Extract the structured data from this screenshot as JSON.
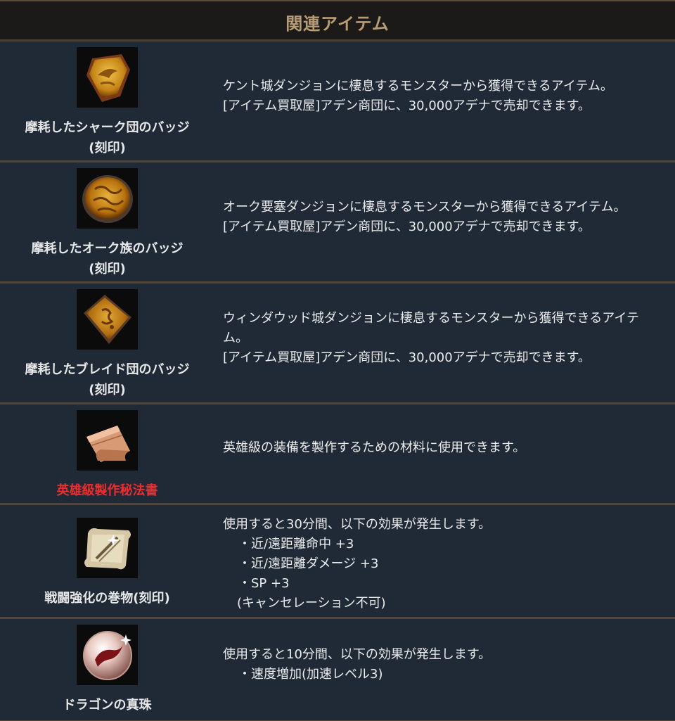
{
  "header": {
    "title": "関連アイテム"
  },
  "items": [
    {
      "icon": "shark-badge-icon",
      "name_line1": "摩耗したシャーク団のバッジ",
      "name_line2": "(刻印)",
      "desc": [
        "ケント城ダンジョンに棲息するモンスターから獲得できるアイテム。",
        "[アイテム買取屋]アデン商団に、30,000アデナで売却できます。"
      ]
    },
    {
      "icon": "orc-badge-icon",
      "name_line1": "摩耗したオーク族のバッジ",
      "name_line2": "(刻印)",
      "desc": [
        "オーク要塞ダンジョンに棲息するモンスターから獲得できるアイテム。",
        "[アイテム買取屋]アデン商団に、30,000アデナで売却できます。"
      ]
    },
    {
      "icon": "blade-badge-icon",
      "name_line1": "摩耗したブレイド団のバッジ",
      "name_line2": "(刻印)",
      "desc": [
        "ウィンダウッド城ダンジョンに棲息するモンスターから獲得できるアイテ",
        "ム。",
        "[アイテム買取屋]アデン商団に、30,000アデナで売却できます。"
      ]
    },
    {
      "icon": "scroll-icon",
      "name_line1": "英雄級製作秘法書",
      "desc": [
        "英雄級の装備を製作するための材料に使用できます。"
      ]
    },
    {
      "icon": "battle-scroll-icon",
      "name_line1": "戦闘強化の巻物(刻印)",
      "desc_intro": "使用すると30分間、以下の効果が発生します。",
      "bullets": [
        "・近/遠距離命中 +3",
        "・近/遠距離ダメージ +3",
        "・SP +3"
      ],
      "note": "(キャンセレーション不可)"
    },
    {
      "icon": "dragon-pearl-icon",
      "name_line1": "ドラゴンの真珠",
      "desc_intro": "使用すると10分間、以下の効果が発生します。",
      "bullets": [
        "・速度増加(加速レベル3)"
      ]
    }
  ],
  "colors": {
    "background": "#1f2a36",
    "header_bg": "#1b1a19",
    "header_text": "#b89c74",
    "divider": "#55463a",
    "hero_name": "#ee2c2c"
  }
}
